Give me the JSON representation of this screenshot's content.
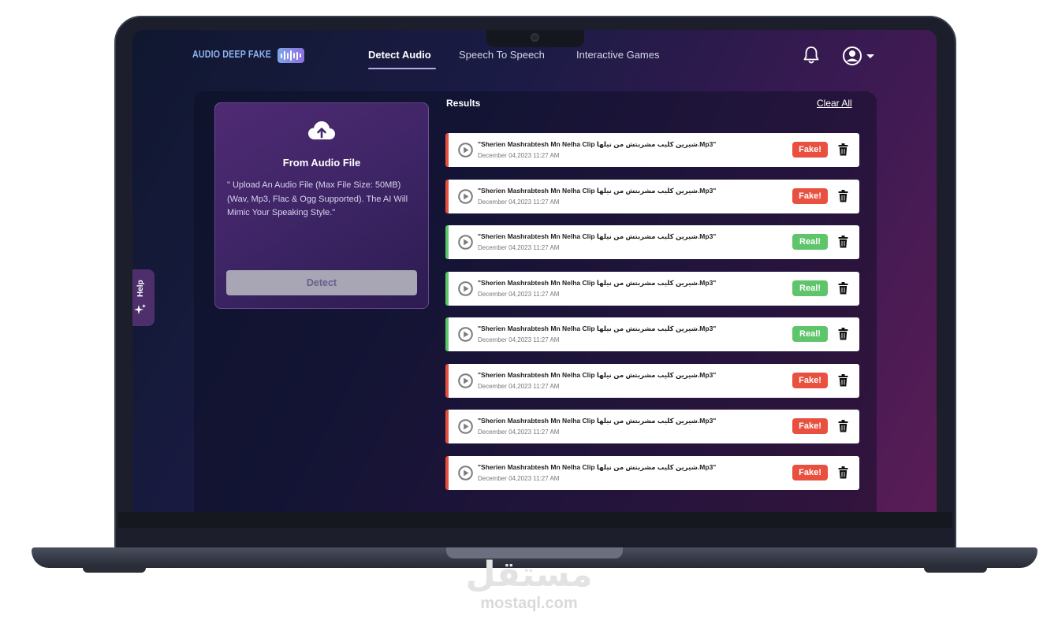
{
  "app": {
    "logo_text": "AUDIO DEEP FAKE"
  },
  "nav": {
    "items": [
      {
        "label": "Detect Audio",
        "active": true
      },
      {
        "label": "Speech To Speech",
        "active": false
      },
      {
        "label": "Interactive Games",
        "active": false
      }
    ],
    "icons": {
      "notifications": "bell-icon",
      "account": "user-circle-icon",
      "account_menu": "caret-down-icon"
    }
  },
  "upload": {
    "icon": "cloud-upload-icon",
    "title": "From Audio File",
    "description": "\" Upload An Audio File (Max File Size: 50MB) (Wav, Mp3, Flac & Ogg Supported). The AI Will Mimic Your Speaking Style.\"",
    "button_label": "Detect"
  },
  "help": {
    "label": "Help",
    "icon": "sparkle-icon"
  },
  "results": {
    "title": "Results",
    "clear_all_label": "Clear All",
    "items": [
      {
        "name": "\"Sherien Mashrabtesh Mn Nelha Clip شيرين كليب مشربتش من نيلها.Mp3\"",
        "date": "December 04,2023 11:27 AM",
        "verdict": "Fake!",
        "status": "fake"
      },
      {
        "name": "\"Sherien Mashrabtesh Mn Nelha Clip شيرين كليب مشربتش من نيلها.Mp3\"",
        "date": "December 04,2023 11:27 AM",
        "verdict": "Fake!",
        "status": "fake"
      },
      {
        "name": "\"Sherien Mashrabtesh Mn Nelha Clip شيرين كليب مشربتش من نيلها.Mp3\"",
        "date": "December 04,2023 11:27 AM",
        "verdict": "Real!",
        "status": "real"
      },
      {
        "name": "\"Sherien Mashrabtesh Mn Nelha Clip شيرين كليب مشربتش من نيلها.Mp3\"",
        "date": "December 04,2023 11:27 AM",
        "verdict": "Real!",
        "status": "real"
      },
      {
        "name": "\"Sherien Mashrabtesh Mn Nelha Clip شيرين كليب مشربتش من نيلها.Mp3\"",
        "date": "December 04,2023 11:27 AM",
        "verdict": "Real!",
        "status": "real"
      },
      {
        "name": "\"Sherien Mashrabtesh Mn Nelha Clip شيرين كليب مشربتش من نيلها.Mp3\"",
        "date": "December 04,2023 11:27 AM",
        "verdict": "Fake!",
        "status": "fake"
      },
      {
        "name": "\"Sherien Mashrabtesh Mn Nelha Clip شيرين كليب مشربتش من نيلها.Mp3\"",
        "date": "December 04,2023 11:27 AM",
        "verdict": "Fake!",
        "status": "fake"
      },
      {
        "name": "\"Sherien Mashrabtesh Mn Nelha Clip شيرين كليب مشربتش من نيلها.Mp3\"",
        "date": "December 04,2023 11:27 AM",
        "verdict": "Fake!",
        "status": "fake"
      }
    ]
  },
  "colors": {
    "fake": "#e9503f",
    "real": "#5ec56b",
    "accent": "#b9a8e8",
    "logo": "#8fb3ec"
  },
  "watermark": {
    "arabic": "مستقل",
    "latin": "mostaql.com"
  }
}
